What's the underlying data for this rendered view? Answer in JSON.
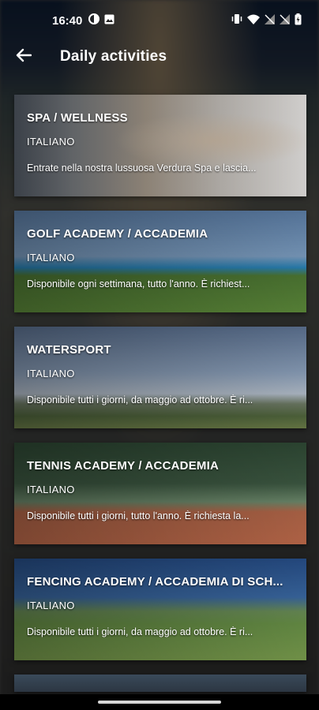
{
  "status_bar": {
    "time": "16:40",
    "left_icons": [
      "half-circle-icon",
      "image-icon"
    ],
    "right_icons": [
      "vibrate-icon",
      "wifi-icon",
      "signal-off-icon",
      "signal-off-icon",
      "battery-charging-icon"
    ]
  },
  "header": {
    "back_icon": "arrow-left-icon",
    "title": "Daily activities"
  },
  "activities": [
    {
      "title": "SPA / WELLNESS",
      "language": "ITALIANO",
      "description": "Entrate nella nostra lussuosa Verdura Spa e lascia..."
    },
    {
      "title": "GOLF ACADEMY / ACCADEMIA",
      "language": "ITALIANO",
      "description": "Disponibile ogni settimana, tutto l'anno. È richiest..."
    },
    {
      "title": "WATERSPORT",
      "language": "ITALIANO",
      "description": "Disponibile tutti i giorni, da maggio ad ottobre. È ri..."
    },
    {
      "title": "TENNIS ACADEMY / ACCADEMIA",
      "language": "ITALIANO",
      "description": "Disponibile tutti i giorni, tutto l'anno. È richiesta la..."
    },
    {
      "title": "FENCING ACADEMY / ACCADEMIA DI SCH...",
      "language": "ITALIANO",
      "description": "Disponibile tutti i giorni, da maggio ad ottobre. È ri..."
    }
  ],
  "colors": {
    "text": "#ffffff",
    "nav_handle": "#d6d6d6"
  }
}
